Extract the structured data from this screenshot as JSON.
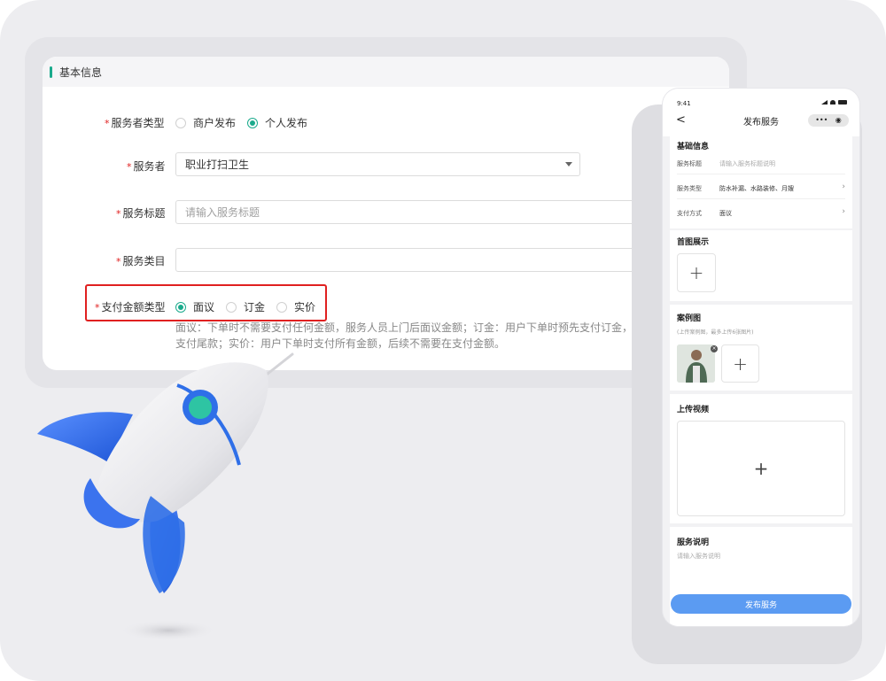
{
  "form": {
    "section_title": "基本信息",
    "required_mark": "*",
    "provider_type": {
      "label": "服务者类型",
      "options": [
        "商户发布",
        "个人发布"
      ],
      "selected_index": 1
    },
    "provider": {
      "label": "服务者",
      "value": "职业打扫卫生"
    },
    "service_title": {
      "label": "服务标题",
      "placeholder": "请输入服务标题"
    },
    "service_category": {
      "label": "服务类目",
      "value": ""
    },
    "payment_type": {
      "label": "支付金额类型",
      "options": [
        "面议",
        "订金",
        "实价"
      ],
      "selected_index": 0
    },
    "payment_desc_line1": "面议：下单时不需要支付任何金额，服务人员上门后面议金额；订金：用户下单时预先支付订金，服务人员上门后",
    "payment_desc_line2": "支付尾款；实价：用户下单时支付所有金额，后续不需要在支付金额。"
  },
  "phone": {
    "status_time": "9:41",
    "nav_back": "<",
    "nav_title": "发布服务",
    "capsule_more": "•••",
    "capsule_close": "◉",
    "basic_section": {
      "title": "基础信息",
      "rows": [
        {
          "key": "服务标题",
          "value": "请输入服务标题说明",
          "placeholder": true,
          "chevron": false
        },
        {
          "key": "服务类型",
          "value": "防水补漏、水路装修、月嫂",
          "placeholder": false,
          "chevron": true
        },
        {
          "key": "支付方式",
          "value": "面议",
          "placeholder": false,
          "chevron": true
        }
      ],
      "chevron_glyph": "›"
    },
    "cover_section": {
      "title": "首图展示",
      "add_glyph": "+"
    },
    "case_section": {
      "title": "案例图",
      "tip": "(上传案例图，最多上传6张图片)",
      "remove_glyph": "×",
      "add_glyph": "+"
    },
    "video_section": {
      "title": "上传视频",
      "add_glyph": "+"
    },
    "desc_section": {
      "title": "服务说明",
      "placeholder": "请输入服务说明"
    },
    "publish_button": "发布服务"
  },
  "colors": {
    "accent_green": "#1aaa8c",
    "highlight_red": "#e02020",
    "rocket_blue": "#2f6fe8",
    "publish_blue": "#5b9bf2"
  }
}
